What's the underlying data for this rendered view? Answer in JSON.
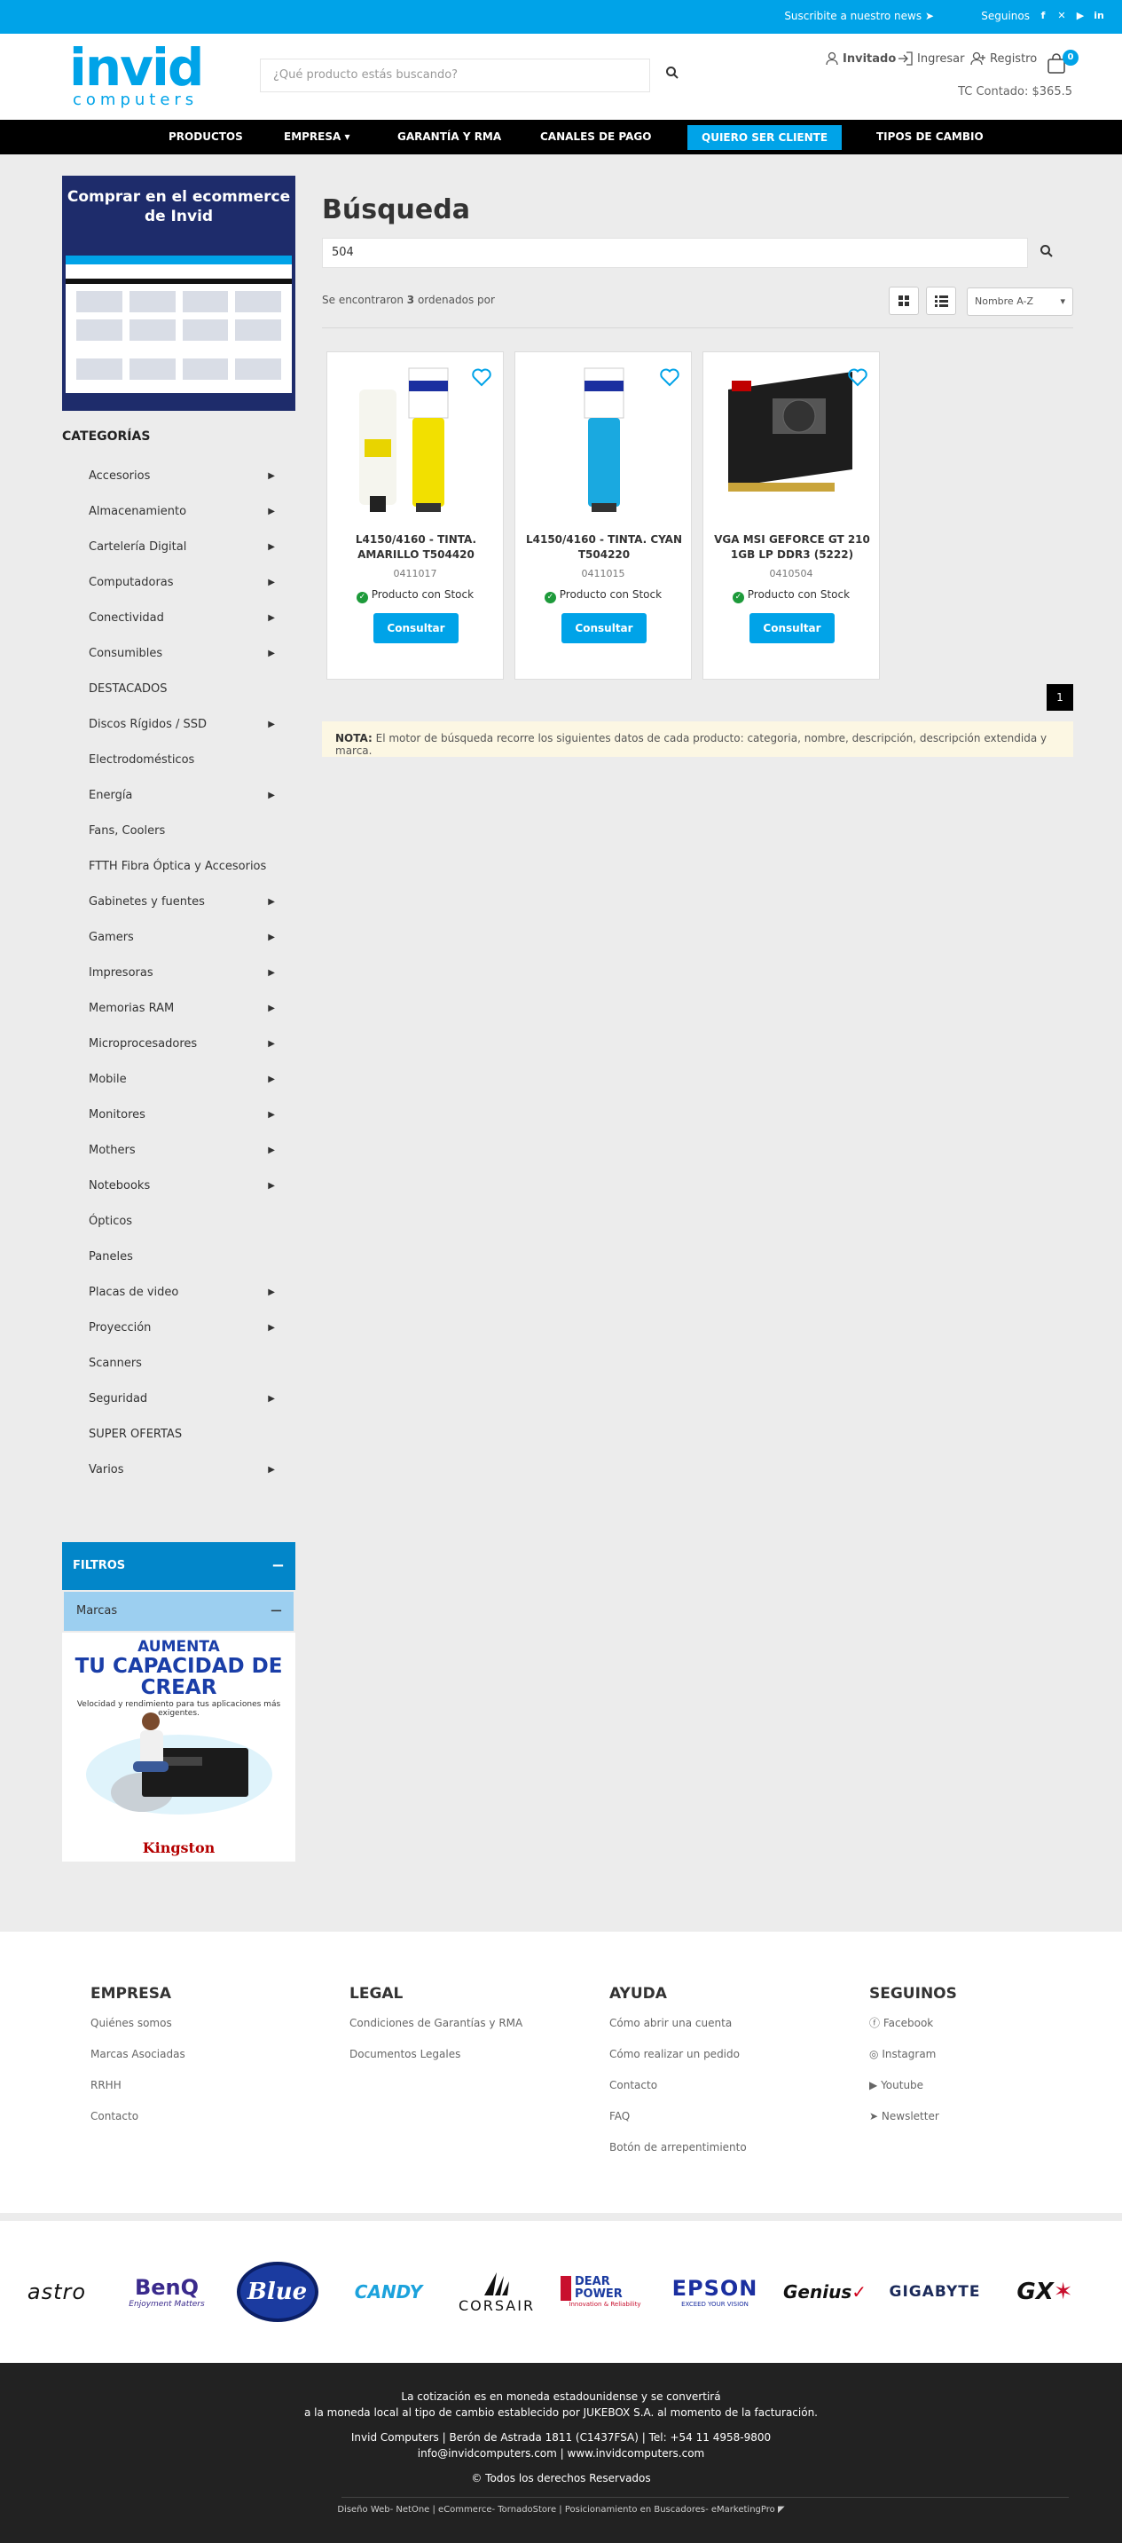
{
  "topbar": {
    "subscribe": "Suscribite a nuestro news",
    "follow_label": "Seguinos"
  },
  "header": {
    "logo_main": "invid",
    "logo_sub": "computers",
    "search_placeholder": "¿Qué producto estás buscando?",
    "user_label": "Invitado",
    "login_label": "Ingresar",
    "register_label": "Registro",
    "cart_count": "0",
    "exchange_rate": "TC Contado: $365.5"
  },
  "nav": {
    "products": "PRODUCTOS",
    "company": "EMPRESA",
    "warranty": "GARANTÍA Y RMA",
    "payment": "CANALES DE PAGO",
    "become_client": "QUIERO SER CLIENTE",
    "exchange": "TIPOS DE CAMBIO"
  },
  "sidebar": {
    "promo_title": "Comprar en el  ecommerce de  Invid",
    "categories_title": "CATEGORÍAS",
    "categories": [
      {
        "label": "Accesorios",
        "arrow": "▶"
      },
      {
        "label": "Almacenamiento",
        "arrow": "▶"
      },
      {
        "label": "Cartelería Digital",
        "arrow": "▶"
      },
      {
        "label": "Computadoras",
        "arrow": "▶"
      },
      {
        "label": "Conectividad",
        "arrow": "▶"
      },
      {
        "label": "Consumibles",
        "arrow": "▶"
      },
      {
        "label": "DESTACADOS",
        "arrow": ""
      },
      {
        "label": "Discos Rígidos / SSD",
        "arrow": "▶"
      },
      {
        "label": "Electrodomésticos",
        "arrow": ""
      },
      {
        "label": "Energía",
        "arrow": "▶"
      },
      {
        "label": "Fans, Coolers",
        "arrow": ""
      },
      {
        "label": "FTTH Fibra Óptica y Accesorios",
        "arrow": ""
      },
      {
        "label": "Gabinetes y fuentes",
        "arrow": "▶"
      },
      {
        "label": "Gamers",
        "arrow": "▶"
      },
      {
        "label": "Impresoras",
        "arrow": "▶"
      },
      {
        "label": "Memorias RAM",
        "arrow": "▶"
      },
      {
        "label": "Microprocesadores",
        "arrow": "▶"
      },
      {
        "label": "Mobile",
        "arrow": "▶"
      },
      {
        "label": "Monitores",
        "arrow": "▶"
      },
      {
        "label": "Mothers",
        "arrow": "▶"
      },
      {
        "label": "Notebooks",
        "arrow": "▶"
      },
      {
        "label": "Ópticos",
        "arrow": ""
      },
      {
        "label": "Paneles",
        "arrow": ""
      },
      {
        "label": "Placas de video",
        "arrow": "▶"
      },
      {
        "label": "Proyección",
        "arrow": "▶"
      },
      {
        "label": "Scanners",
        "arrow": ""
      },
      {
        "label": "Seguridad",
        "arrow": "▶"
      },
      {
        "label": "SUPER OFERTAS",
        "arrow": ""
      },
      {
        "label": "Varios",
        "arrow": "▶"
      }
    ],
    "filters_title": "FILTROS",
    "brands_filter": "Marcas",
    "ad_line1": "AUMENTA",
    "ad_line2": "TU CAPACIDAD DE CREAR",
    "ad_line3": "Velocidad y rendimiento para tus aplicaciones más exigentes.",
    "ad_brand": "Kingston"
  },
  "main": {
    "title": "Búsqueda",
    "query": "504",
    "found_prefix": "Se encontraron ",
    "found_count": "3",
    "found_suffix": " ordenados por",
    "sort_value": "Nombre A-Z",
    "products": [
      {
        "name": "L4150/4160 - TINTA. AMARILLO T504420",
        "code": "0411017",
        "stock": "Producto con Stock",
        "button": "Consultar",
        "color": "#f2e000"
      },
      {
        "name": "L4150/4160 - TINTA. CYAN T504220",
        "code": "0411015",
        "stock": "Producto con Stock",
        "button": "Consultar",
        "color": "#1aa9e0"
      },
      {
        "name": "VGA MSI GEFORCE GT 210 1GB LP DDR3 (5222)",
        "code": "0410504",
        "stock": "Producto con Stock",
        "button": "Consultar",
        "color": "#c00000"
      }
    ],
    "page": "1",
    "note_label": "NOTA:",
    "note_text": " El motor de búsqueda recorre los siguientes datos de cada producto: categoria, nombre, descripción, descripción extendida y marca."
  },
  "footer": {
    "company_title": "EMPRESA",
    "company_links": [
      "Quiénes somos",
      "Marcas Asociadas",
      "RRHH",
      "Contacto"
    ],
    "legal_title": "LEGAL",
    "legal_links": [
      "Condiciones de Garantías y RMA",
      "Documentos Legales"
    ],
    "help_title": "AYUDA",
    "help_links": [
      "Cómo abrir una cuenta",
      "Cómo realizar un pedido",
      "Contacto",
      "FAQ",
      "Botón de arrepentimiento"
    ],
    "follow_title": "SEGUINOS",
    "follow_links": [
      "Facebook",
      "Instagram",
      "Youtube",
      "Newsletter"
    ]
  },
  "brands": [
    "astro",
    "BenQ",
    "Blue",
    "CANDY",
    "CORSAIR",
    "DEAR POWER",
    "EPSON",
    "Genius",
    "GIGABYTE",
    "GX"
  ],
  "brand_extras": {
    "benq_tag": "Enjoyment Matters",
    "epson_tag": "EXCEED YOUR VISION",
    "dp_tag": "Innovation & Reliability"
  },
  "bottom": {
    "line1": "La cotización es en moneda estadounidense y se convertirá",
    "line2": "a la moneda local al tipo de cambio establecido por JUKEBOX S.A. al momento de la facturación.",
    "line3": "Invid Computers | Berón de Astrada 1811 (C1437FSA) | Tel: +54 11 4958-9800",
    "line4": "info@invidcomputers.com | www.invidcomputers.com",
    "line5": "© Todos los derechos Reservados",
    "credits": "Diseño Web- NetOne | eCommerce- TornadoStore | Posicionamiento en Buscadores- eMarketingPro"
  },
  "colors": {
    "accent": "#00a3e8",
    "nav": "#000000",
    "filter_header": "#0286c9"
  }
}
